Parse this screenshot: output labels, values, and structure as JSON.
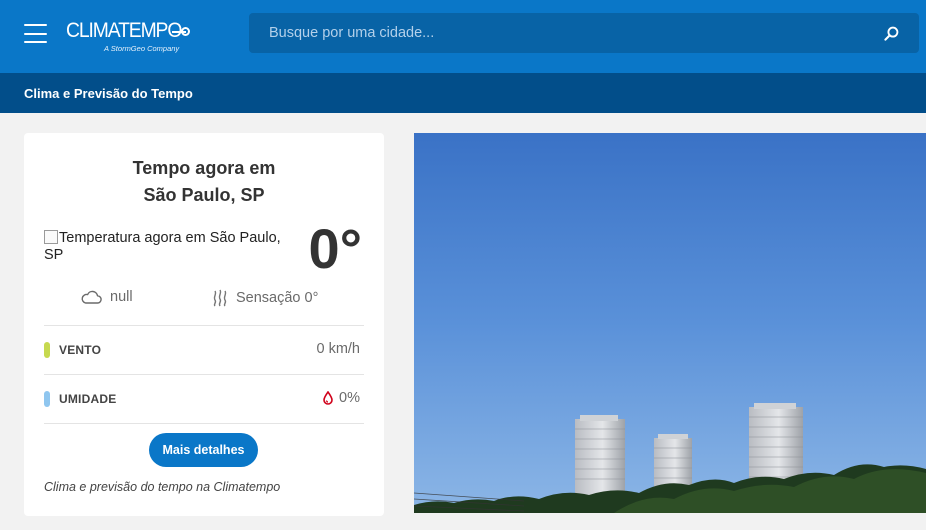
{
  "header": {
    "menu_icon": "hamburger-menu-icon",
    "logo_text": "CLIMATEMPO",
    "logo_subtitle": "A StormGeo Company",
    "search_placeholder": "Busque por uma cidade...",
    "search_icon": "search-icon"
  },
  "breadcrumb": {
    "label": "Clima e Previsão do Tempo"
  },
  "weather_card": {
    "title_line1": "Tempo agora em",
    "title_line2": "São Paulo, SP",
    "image_alt": "Temperatura agora em São Paulo, SP",
    "temperature": "0°",
    "condition": "null",
    "condition_icon": "cloud-icon",
    "feels_like": "Sensação 0°",
    "feels_like_icon": "heat-waves-icon",
    "wind": {
      "label": "VENTO",
      "value": "0 km/h",
      "color": "#c6d94f"
    },
    "humidity": {
      "label": "UMIDADE",
      "value": "0%",
      "color": "#8fc6ef",
      "icon": "water-drop-icon"
    },
    "details_button": "Mais detalhes",
    "footer": "Clima e previsão do tempo na Climatempo"
  },
  "photo": {
    "description_icon": "city-skyline-photo"
  },
  "colors": {
    "topbar": "#0a77c8",
    "breadbar": "#024e8a",
    "search_bg": "#0863a6",
    "accent": "#0a77c8",
    "drop": "#d0021b"
  }
}
